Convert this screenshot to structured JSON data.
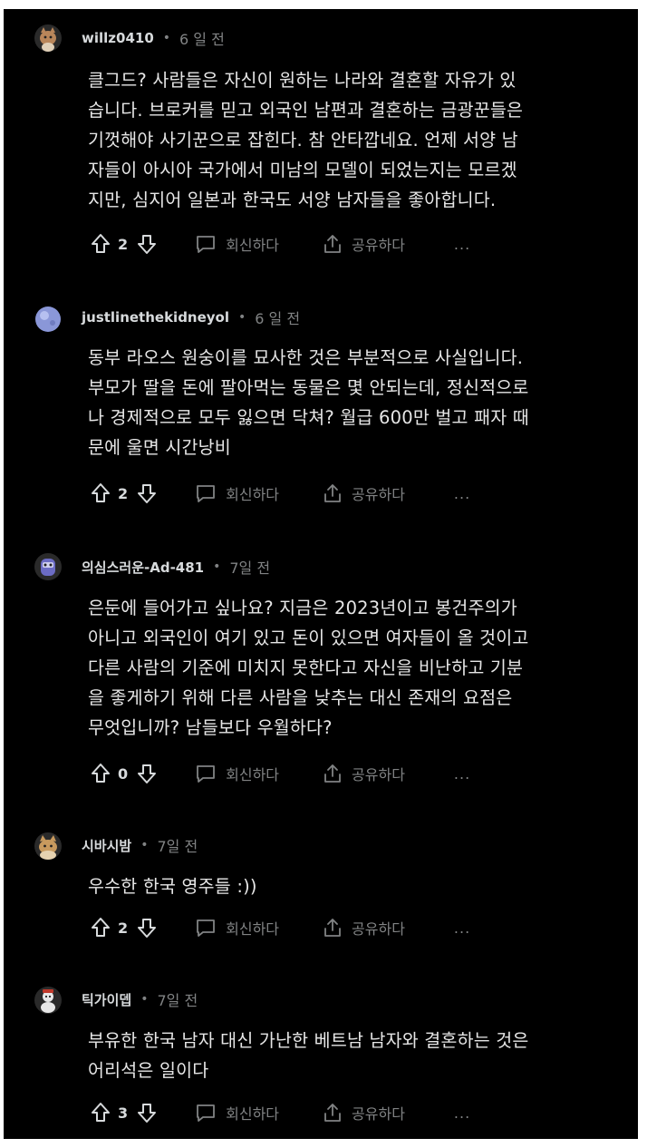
{
  "comments": [
    {
      "username": "willz0410",
      "time": "6 일 전",
      "avatar_icon": "cat-avatar-icon",
      "avatar_color": "#b9865a",
      "lines": [
        "클그드? 사람들은 자신이 원하는 나라와 결혼할 자유가 있",
        "습니다. 브로커를 믿고 외국인 남편과 결혼하는 금광꾼들은",
        "기껏해야 사기꾼으로 잡힌다. 참 안타깝네요. 언제 서양 남",
        "자들이 아시아 국가에서 미남의 모델이 되었는지는 모르겠",
        "지만, 심지어 일본과 한국도 서양 남자들을 좋아합니다."
      ],
      "votes": "2",
      "reply_label": "회신하다",
      "share_label": "공유하다",
      "more_label": "..."
    },
    {
      "username": "justlinethekidneyol",
      "time": "6 일 전",
      "avatar_icon": "planet-avatar-icon",
      "avatar_color": "#8a97d8",
      "lines": [
        "동부 라오스 원숭이를 묘사한 것은 부분적으로 사실입니다.",
        "부모가 딸을 돈에 팔아먹는 동물은 몇 안되는데, 정신적으로",
        "나 경제적으로 모두 잃으면 닥쳐? 월급 600만 벌고 패자 때",
        "문에 울면 시간낭비"
      ],
      "votes": "2",
      "reply_label": "회신하다",
      "share_label": "공유하다",
      "more_label": "..."
    },
    {
      "username": "의심스러운-Ad-481",
      "time": "7일 전",
      "avatar_icon": "alien-avatar-icon",
      "avatar_color": "#6c6cc4",
      "lines": [
        "은둔에 들어가고 싶나요? 지금은 2023년이고 봉건주의가",
        "아니고 외국인이 여기 있고 돈이 있으면 여자들이 올 것이고",
        "다른 사람의 기준에 미치지 못한다고 자신을 비난하고 기분",
        "을 좋게하기 위해 다른 사람을 낮추는 대신 존재의 요점은",
        "무엇입니까? 남들보다 우월하다?"
      ],
      "votes": "0",
      "reply_label": "회신하다",
      "share_label": "공유하다",
      "more_label": "..."
    },
    {
      "username": "시바시밤",
      "time": "7일 전",
      "avatar_icon": "dog-avatar-icon",
      "avatar_color": "#c89a5e",
      "lines": [
        "우수한 한국 영주들 :))"
      ],
      "votes": "2",
      "reply_label": "회신하다",
      "share_label": "공유하다",
      "more_label": "..."
    },
    {
      "username": "틱가이뎁",
      "time": "7일 전",
      "avatar_icon": "snowman-avatar-icon",
      "avatar_color": "#e8e8e8",
      "lines": [
        "부유한 한국 남자 대신 가난한 베트남 남자와 결혼하는 것은",
        "어리석은 일이다"
      ],
      "votes": "3",
      "reply_label": "회신하다",
      "share_label": "공유하다",
      "more_label": "..."
    }
  ]
}
